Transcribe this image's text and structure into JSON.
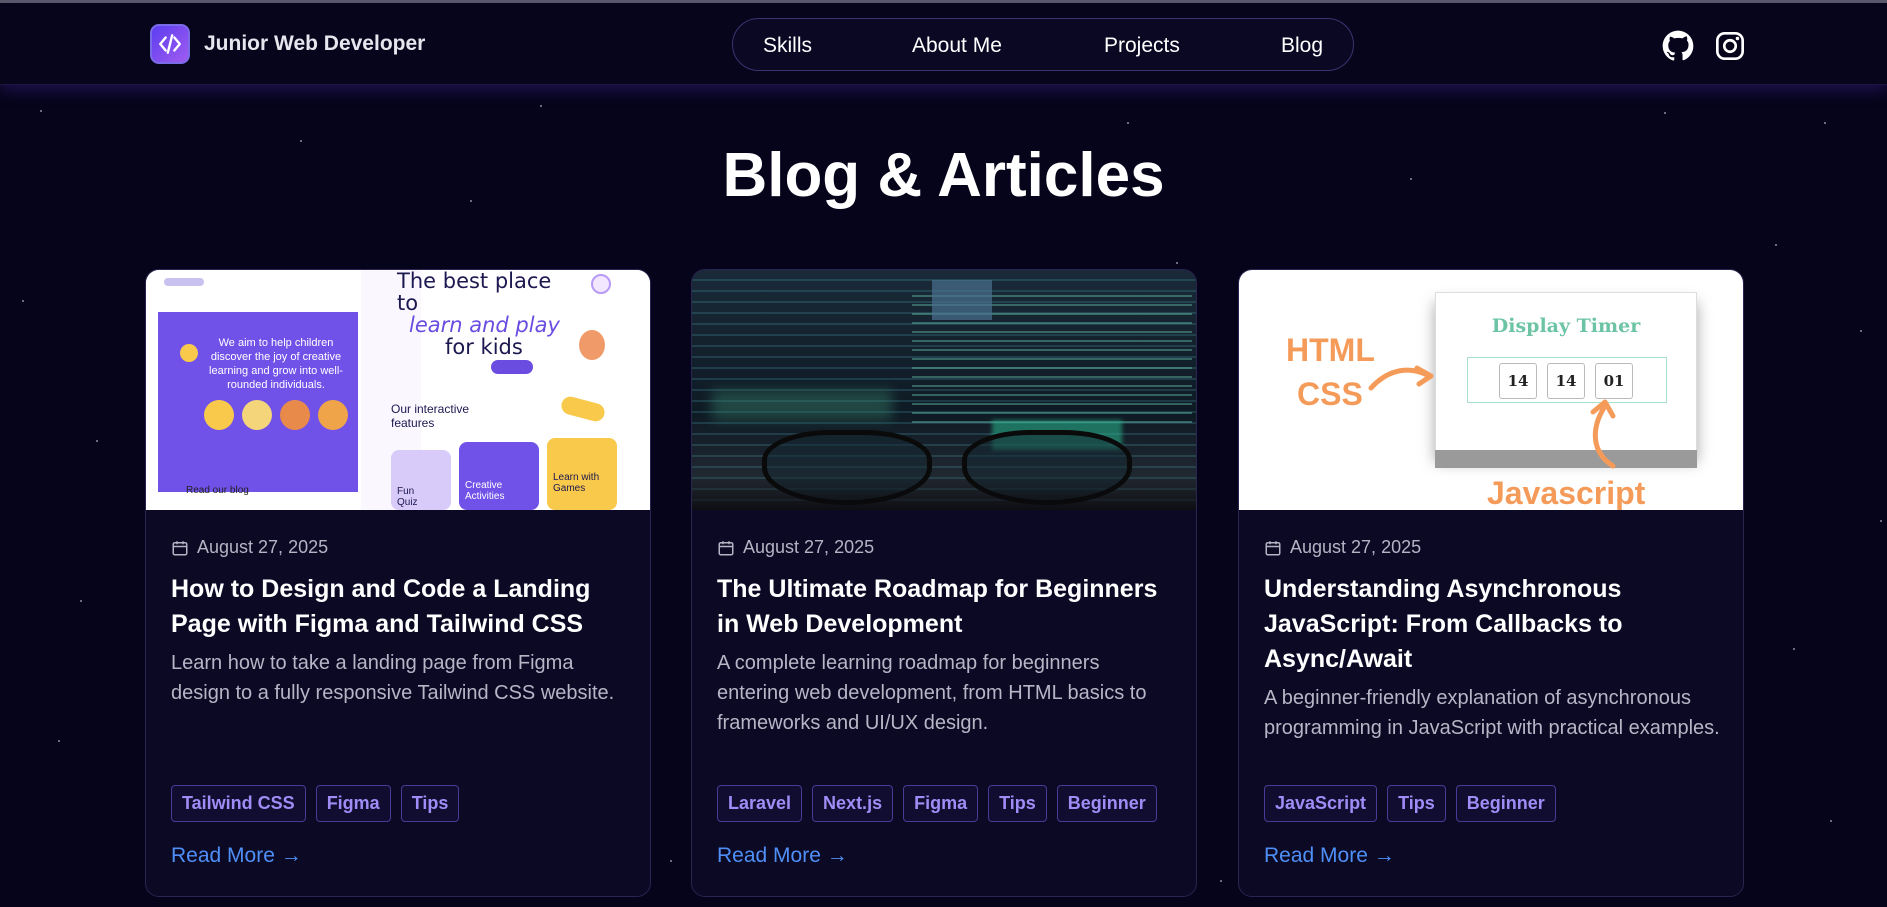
{
  "header": {
    "brand_name": "Junior Web Developer",
    "nav": [
      "Skills",
      "About Me",
      "Projects",
      "Blog"
    ],
    "socials": [
      "github-icon",
      "instagram-icon"
    ]
  },
  "page_title": "Blog & Articles",
  "colors": {
    "background": "#06041a",
    "accent_purple": "#a08cf6",
    "link_blue": "#4f8ff7"
  },
  "cards": [
    {
      "date": "August 27, 2025",
      "title": "How to Design and Code a Landing Page with Figma and Tailwind CSS",
      "description": "Learn how to take a landing page from Figma design to a fully responsive Tailwind CSS website.",
      "tags": [
        "Tailwind CSS",
        "Figma",
        "Tips"
      ],
      "read_more": "Read More →",
      "image": {
        "left_text": "We aim to help children discover the joy of creative learning and grow into well-rounded individuals.",
        "headline_1": "The best place to",
        "headline_2": "learn and play",
        "headline_3": "for kids",
        "section": "Our interactive features",
        "blog_label": "Read our blog",
        "feature_1": "Fun Quiz",
        "feature_2": "Creative Activities",
        "feature_3": "Learn with Games"
      }
    },
    {
      "date": "August 27, 2025",
      "title": "The Ultimate Roadmap for Beginners in Web Development",
      "description": "A complete learning roadmap for beginners entering web development, from HTML basics to frameworks and UI/UX design.",
      "tags": [
        "Laravel",
        "Next.js",
        "Figma",
        "Tips",
        "Beginner"
      ],
      "read_more": "Read More →"
    },
    {
      "date": "August 27, 2025",
      "title": "Understanding Asynchronous JavaScript: From Callbacks to Async/Await",
      "description": "A beginner-friendly explanation of asynchronous programming in JavaScript with practical examples.",
      "tags": [
        "JavaScript",
        "Tips",
        "Beginner"
      ],
      "read_more": "Read More →",
      "image": {
        "label_html": "HTML",
        "label_css": "CSS",
        "timer_title": "Display Timer",
        "timer_values": [
          "14",
          "14",
          "01"
        ],
        "label_js": "Javascript"
      }
    }
  ]
}
